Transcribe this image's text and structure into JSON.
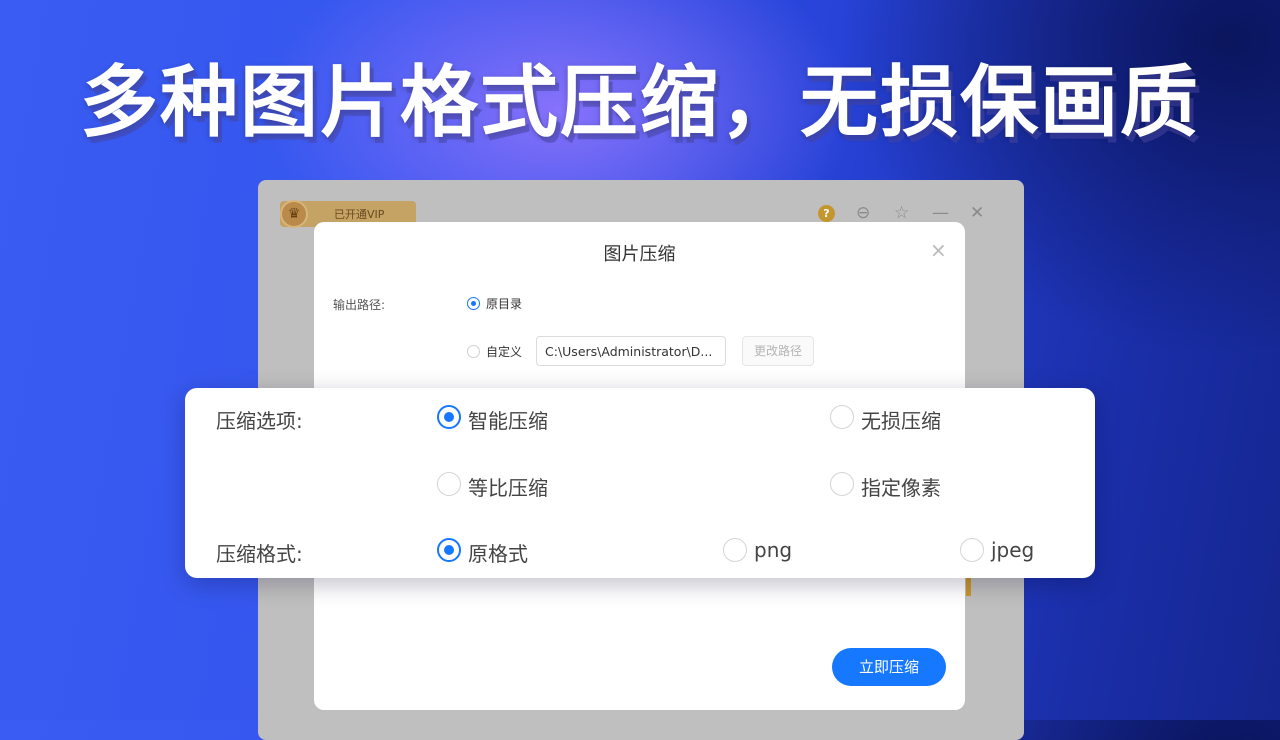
{
  "headline": "多种图片格式压缩，无损保画质",
  "app": {
    "vip_label": "已开通VIP",
    "crown_glyph": "♛",
    "help_glyph": "?",
    "menu_glyph": "⊖",
    "star_glyph": "☆",
    "minimize_glyph": "—",
    "close_glyph": "✕"
  },
  "dialog": {
    "title": "图片压缩",
    "close_glyph": "×",
    "output_path_label": "输出路径:",
    "option_original_dir": "原目录",
    "option_custom": "自定义",
    "path_value": "C:\\Users\\Administrator\\D...",
    "change_path_button": "更改路径",
    "compress_button": "立即压缩"
  },
  "options": {
    "compress_option_label": "压缩选项:",
    "smart_compress": "智能压缩",
    "lossless_compress": "无损压缩",
    "proportional_compress": "等比压缩",
    "specified_pixels": "指定像素",
    "format_label": "压缩格式:",
    "format_original": "原格式",
    "format_png": "png",
    "format_jpeg": "jpeg",
    "selected_option": "智能压缩",
    "selected_format": "原格式"
  },
  "colors": {
    "accent": "#1677ff",
    "vip_gold": "#c4a364"
  }
}
